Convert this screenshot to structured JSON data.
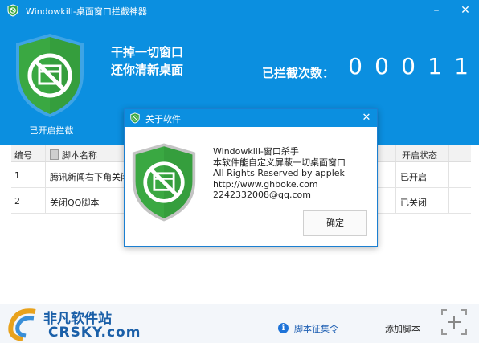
{
  "app": {
    "title": "Windowkill-桌面窗口拦截神器",
    "shield_caption": "已开启拦截",
    "slogan_line1": "干掉一切窗口",
    "slogan_line2": "还你清新桌面",
    "count_label": "已拦截次数：",
    "count_digits": [
      "0",
      "0",
      "0",
      "1",
      "1"
    ],
    "brand_color": "#0b8fe0",
    "shield_color": "#3aa842"
  },
  "table": {
    "headers": {
      "id": "编号",
      "name": "脚本名称",
      "status": "开启状态"
    },
    "rows": [
      {
        "id": "1",
        "name": "腾讯新闻右下角关闭",
        "status": "已开启"
      },
      {
        "id": "2",
        "name": "关闭QQ脚本",
        "status": "已关闭"
      }
    ]
  },
  "footer": {
    "logo_cn": "非凡软件站",
    "logo_en": "CRSKY.com",
    "collect_link": "脚本征集令",
    "add_script": "添加脚本"
  },
  "dialog": {
    "title": "关于软件",
    "lines": [
      "Windowkill-窗口杀手",
      "本软件能自定义屏蔽一切桌面窗口",
      "All Rights Reserved by applek",
      "http://www.ghboke.com",
      "2242332008@qq.com"
    ],
    "ok_label": "确定"
  }
}
